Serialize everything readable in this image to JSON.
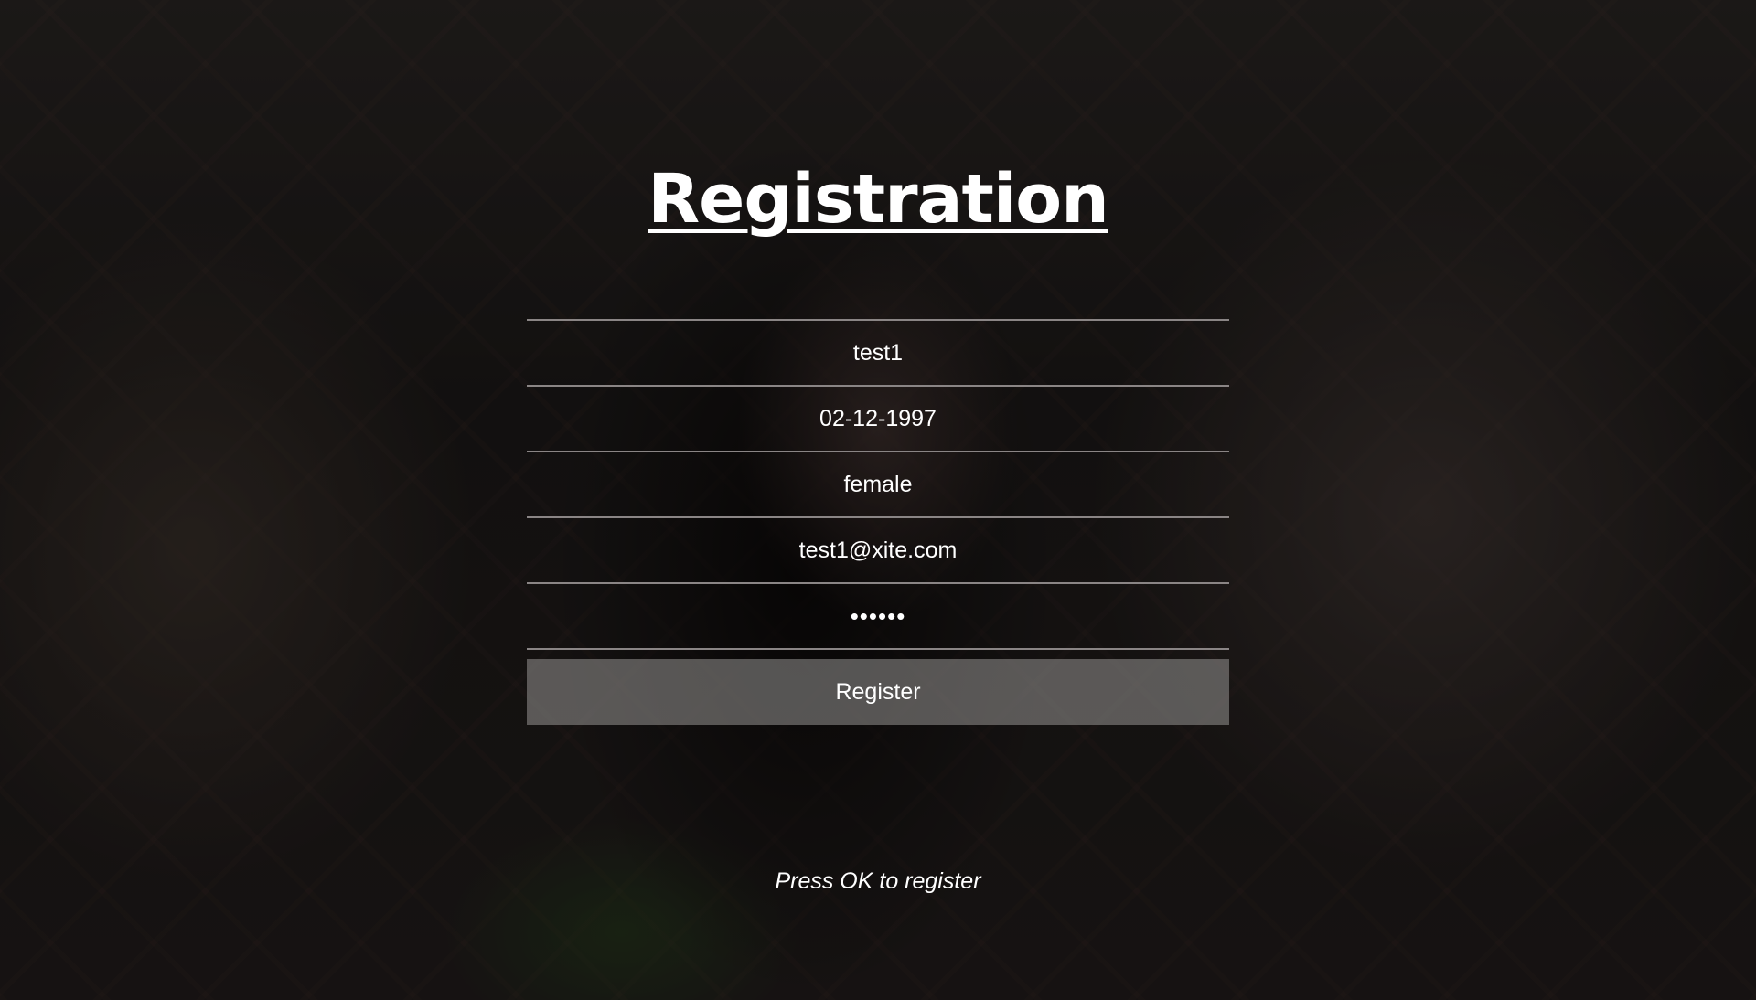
{
  "page": {
    "title": "Registration"
  },
  "form": {
    "fields": [
      {
        "name": "username",
        "value": "test1"
      },
      {
        "name": "birthdate",
        "value": "02-12-1997"
      },
      {
        "name": "gender",
        "value": "female"
      },
      {
        "name": "email",
        "value": "test1@xite.com"
      },
      {
        "name": "password",
        "value": "••••••"
      }
    ],
    "register_label": "Register"
  },
  "hint": {
    "text": "Press OK to register"
  },
  "colors": {
    "text": "#ffffff",
    "divider": "#8a8585",
    "button_bg": "#8f8c8a"
  }
}
